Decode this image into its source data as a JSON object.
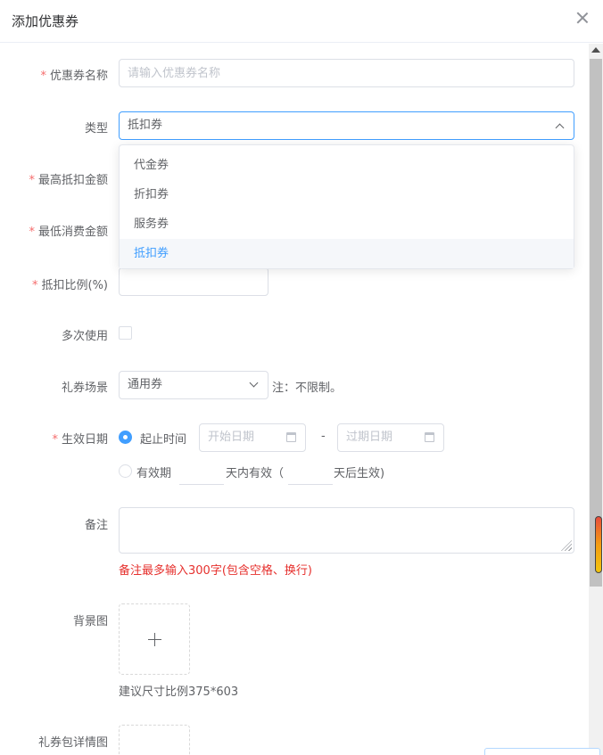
{
  "dialog": {
    "title": "添加优惠券"
  },
  "form": {
    "name": {
      "label": "优惠券名称",
      "required": "*",
      "placeholder": "请输入优惠券名称"
    },
    "type": {
      "label": "类型",
      "value": "抵扣券",
      "options": [
        "代金券",
        "折扣券",
        "服务券",
        "抵扣券"
      ]
    },
    "max_deduction": {
      "label": "最高抵扣金额",
      "required": "*"
    },
    "min_spend": {
      "label": "最低消费金额",
      "required": "*"
    },
    "deduction_ratio": {
      "label": "抵扣比例(%)",
      "required": "*"
    },
    "multi_use": {
      "label": "多次使用",
      "checked": false
    },
    "scene": {
      "label": "礼券场景",
      "value": "通用券",
      "note": "注：不限制。"
    },
    "effective_date": {
      "label": "生效日期",
      "required": "*",
      "radio_range_label": "起止时间",
      "start_placeholder": "开始日期",
      "separator": "-",
      "end_placeholder": "过期日期",
      "radio_validity_label": "有效期",
      "validity_text_1": "天内有效（",
      "validity_text_2": "天后生效)"
    },
    "remark": {
      "label": "备注",
      "error": "备注最多输入300字(包含空格、换行)"
    },
    "background": {
      "label": "背景图",
      "hint": "建议尺寸比例375*603"
    },
    "detail_image": {
      "label": "礼券包详情图"
    }
  },
  "colors": {
    "primary": "#409eff",
    "required": "#f56c6c",
    "error": "#e6312e",
    "text": "#606266"
  }
}
